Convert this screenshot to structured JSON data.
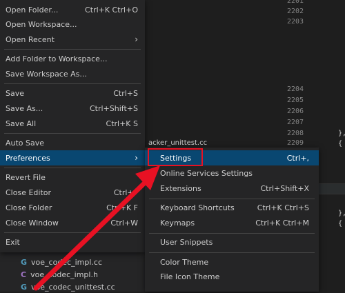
{
  "editor": {
    "line_numbers": [
      "2201",
      "2202",
      "2203",
      "2204",
      "2205",
      "2206",
      "2207",
      "2208",
      "2209"
    ],
    "code_fragments": [
      "},",
      "{",
      "},",
      "{"
    ],
    "partial_tab_text": "acker_unittest.cc"
  },
  "explorer": {
    "files": [
      {
        "icon": "cc-file-icon",
        "label": "voe_codec_impl.cc",
        "icon_char": "G",
        "icon_color": "#519aba"
      },
      {
        "icon": "h-file-icon",
        "label": "voe_codec_impl.h",
        "icon_char": "C",
        "icon_color": "#a074c4"
      },
      {
        "icon": "cc-file-icon",
        "label": "voe_codec_unittest.cc",
        "icon_char": "G",
        "icon_color": "#519aba"
      }
    ]
  },
  "file_menu": {
    "open_folder": {
      "label": "Open Folder...",
      "shortcut": "Ctrl+K Ctrl+O"
    },
    "open_workspace": {
      "label": "Open Workspace..."
    },
    "open_recent": {
      "label": "Open Recent"
    },
    "add_folder": {
      "label": "Add Folder to Workspace..."
    },
    "save_workspace_as": {
      "label": "Save Workspace As..."
    },
    "save": {
      "label": "Save",
      "shortcut": "Ctrl+S"
    },
    "save_as": {
      "label": "Save As...",
      "shortcut": "Ctrl+Shift+S"
    },
    "save_all": {
      "label": "Save All",
      "shortcut": "Ctrl+K S"
    },
    "auto_save": {
      "label": "Auto Save"
    },
    "preferences": {
      "label": "Preferences"
    },
    "revert_file": {
      "label": "Revert File"
    },
    "close_editor": {
      "label": "Close Editor",
      "shortcut": "Ctrl+F"
    },
    "close_folder": {
      "label": "Close Folder",
      "shortcut": "Ctrl+K F"
    },
    "close_window": {
      "label": "Close Window",
      "shortcut": "Ctrl+W"
    },
    "exit": {
      "label": "Exit"
    }
  },
  "preferences_menu": {
    "settings": {
      "label": "Settings",
      "shortcut": "Ctrl+,"
    },
    "online_services": {
      "label": "Online Services Settings"
    },
    "extensions": {
      "label": "Extensions",
      "shortcut": "Ctrl+Shift+X"
    },
    "keyboard_shortcuts": {
      "label": "Keyboard Shortcuts",
      "shortcut": "Ctrl+K Ctrl+S"
    },
    "keymaps": {
      "label": "Keymaps",
      "shortcut": "Ctrl+K Ctrl+M"
    },
    "user_snippets": {
      "label": "User Snippets"
    },
    "color_theme": {
      "label": "Color Theme"
    },
    "file_icon_theme": {
      "label": "File Icon Theme"
    }
  },
  "colors": {
    "highlight": "#094771",
    "annotation_red": "#e81123"
  }
}
